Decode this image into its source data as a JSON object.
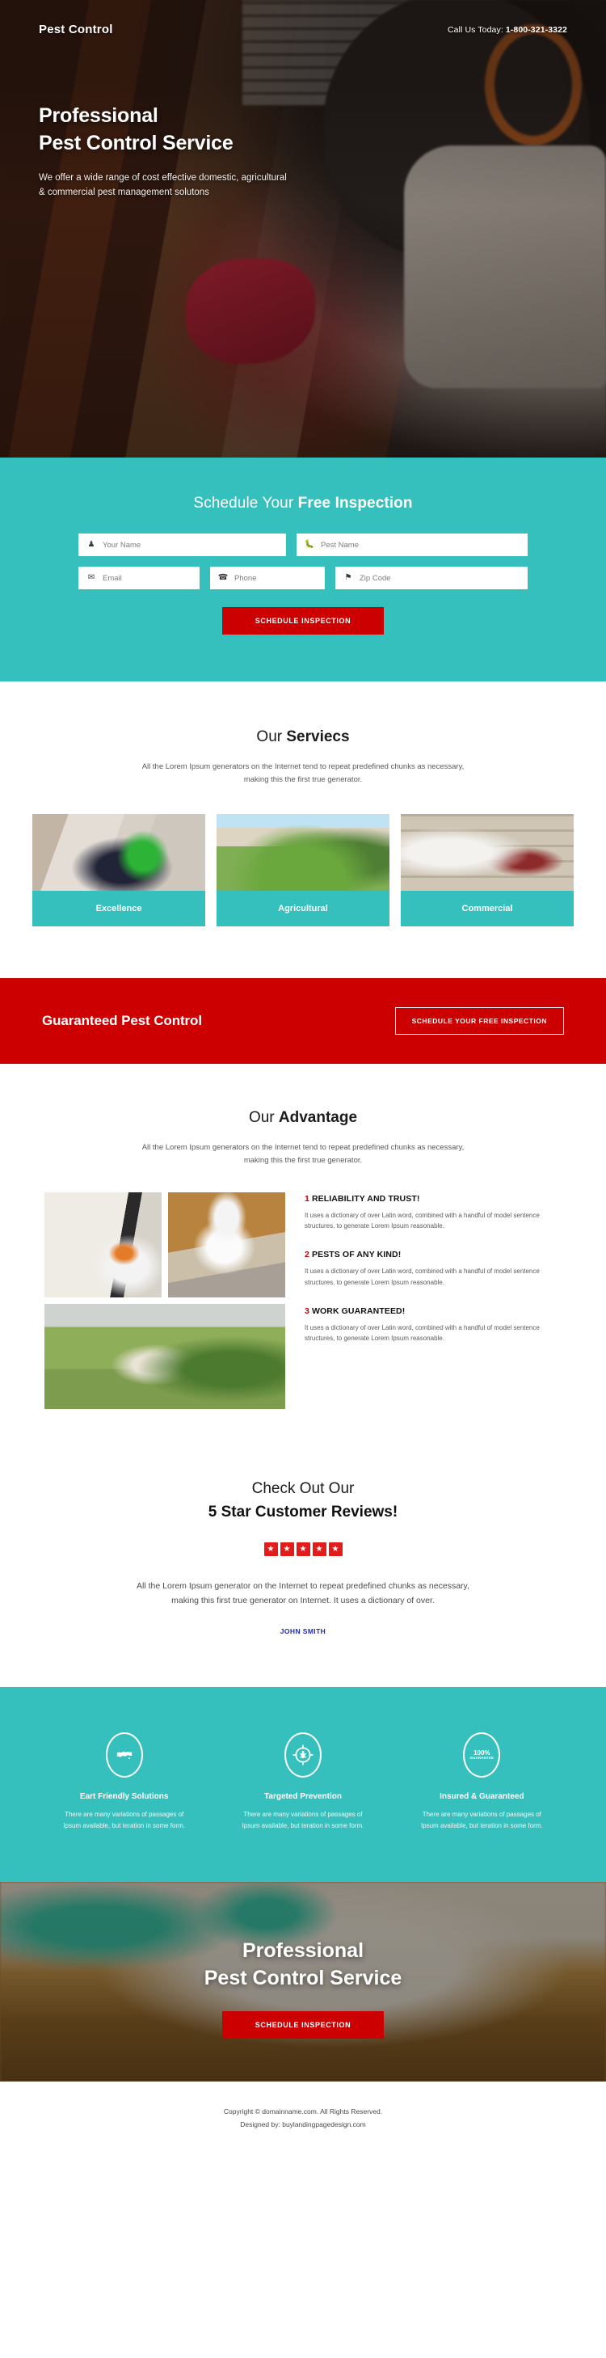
{
  "header": {
    "brand": "Pest Control",
    "phone_prefix": "Call Us Today: ",
    "phone_number": "1-800-321-3322"
  },
  "hero": {
    "title_line1": "Professional",
    "title_line2": "Pest Control Service",
    "subtitle": "We offer a wide range of cost effective domestic, agricultural & commercial pest management solutons"
  },
  "form": {
    "heading_normal": "Schedule Your ",
    "heading_bold": "Free Inspection",
    "fields": [
      {
        "name": "your-name",
        "placeholder": "Your Name",
        "icon": "user-icon",
        "glyph": "♟"
      },
      {
        "name": "pest-name",
        "placeholder": "Pest Name",
        "icon": "bug-icon",
        "glyph": "🐛"
      },
      {
        "name": "email",
        "placeholder": "Email",
        "icon": "envelope-icon",
        "glyph": "✉"
      },
      {
        "name": "phone",
        "placeholder": "Phone",
        "icon": "phone-icon",
        "glyph": "☎"
      },
      {
        "name": "zip-code",
        "placeholder": "Zip Code",
        "icon": "map-pin-icon",
        "glyph": "⚑"
      }
    ],
    "submit_label": "SCHEDULE INSPECTION"
  },
  "services": {
    "title_normal": "Our ",
    "title_bold": "Serviecs",
    "subtitle": "All the Lorem Ipsum generators on the Internet tend to repeat predefined chunks as necessary, making this the first true generator.",
    "cards": [
      {
        "label": "Excellence"
      },
      {
        "label": "Agricultural"
      },
      {
        "label": "Commercial"
      }
    ]
  },
  "red_banner": {
    "heading": "Guaranteed Pest Control",
    "button_label": "SCHEDULE YOUR FREE INSPECTION"
  },
  "advantage": {
    "title_normal": "Our ",
    "title_bold": "Advantage",
    "subtitle": "All the Lorem Ipsum generators on the Internet tend to repeat predefined chunks as necessary, making this the first true generator.",
    "items": [
      {
        "number": "1",
        "heading": "RELIABILITY AND TRUST!",
        "body": "It uses a dictionary of over Latin word, combined with a handful of model sentence structures, to generate Lorem Ipsum reasonable."
      },
      {
        "number": "2",
        "heading": "PESTS OF ANY KIND!",
        "body": "It uses a dictionary of over Latin word, combined with a handful of model sentence structures, to generate Lorem Ipsum reasonable."
      },
      {
        "number": "3",
        "heading": "WORK GUARANTEED!",
        "body": "It uses a dictionary of over Latin word, combined with a handful of model sentence structures, to generate Lorem Ipsum reasonable."
      }
    ]
  },
  "reviews": {
    "line1": "Check Out Our",
    "line2": "5 Star Customer Reviews!",
    "star_count": 5,
    "star_glyph": "★",
    "text": "All the Lorem Ipsum generator on the Internet to repeat predefined chunks as necessary, making this first true generator on Internet. It uses a dictionary of over.",
    "author": "JOHN SMITH"
  },
  "features": [
    {
      "icon": "globe-icon",
      "heading": "Eart Friendly Solutions",
      "body": "There are many variations of passages of Ipsum available, but teration in some form."
    },
    {
      "icon": "target-bug-icon",
      "heading": "Targeted Prevention",
      "body": "There are many variations of passages of Ipsum available, but teration in some form."
    },
    {
      "icon": "guarantee-badge-icon",
      "heading": "Insured & Guaranteed",
      "body": "There are many variations of passages of Ipsum available, but teration in some form.",
      "badge_value": "100%",
      "badge_label": "GUARANTEE"
    }
  ],
  "bottom_cta": {
    "title_line1": "Professional",
    "title_line2": "Pest Control Service",
    "button_label": "SCHEDULE INSPECTION"
  },
  "footer": {
    "line1": "Copyright © domainname.com. All Rights Reserved.",
    "line2": "Designed by: buylandingpagedesign.com"
  },
  "colors": {
    "teal": "#35c0bd",
    "red": "#cc0000",
    "star_red": "#e21b1b",
    "author_blue": "#1c2bb5"
  }
}
